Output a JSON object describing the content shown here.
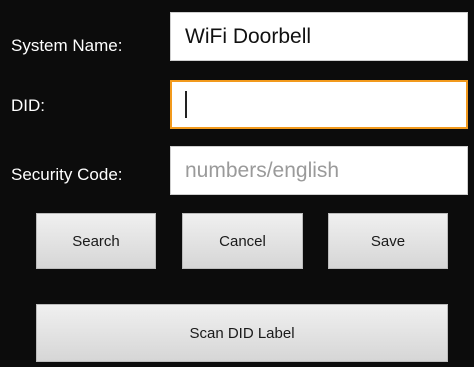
{
  "form": {
    "system_name": {
      "label": "System Name:",
      "value": "WiFi Doorbell"
    },
    "did": {
      "label": "DID:",
      "value": ""
    },
    "security_code": {
      "label": "Security Code:",
      "placeholder": "numbers/english"
    }
  },
  "buttons": {
    "search": "Search",
    "cancel": "Cancel",
    "save": "Save",
    "scan": "Scan DID Label"
  },
  "colors": {
    "background": "#0c0c0c",
    "focus_border": "#f29a1d",
    "button_face": "#e4e4e4"
  }
}
